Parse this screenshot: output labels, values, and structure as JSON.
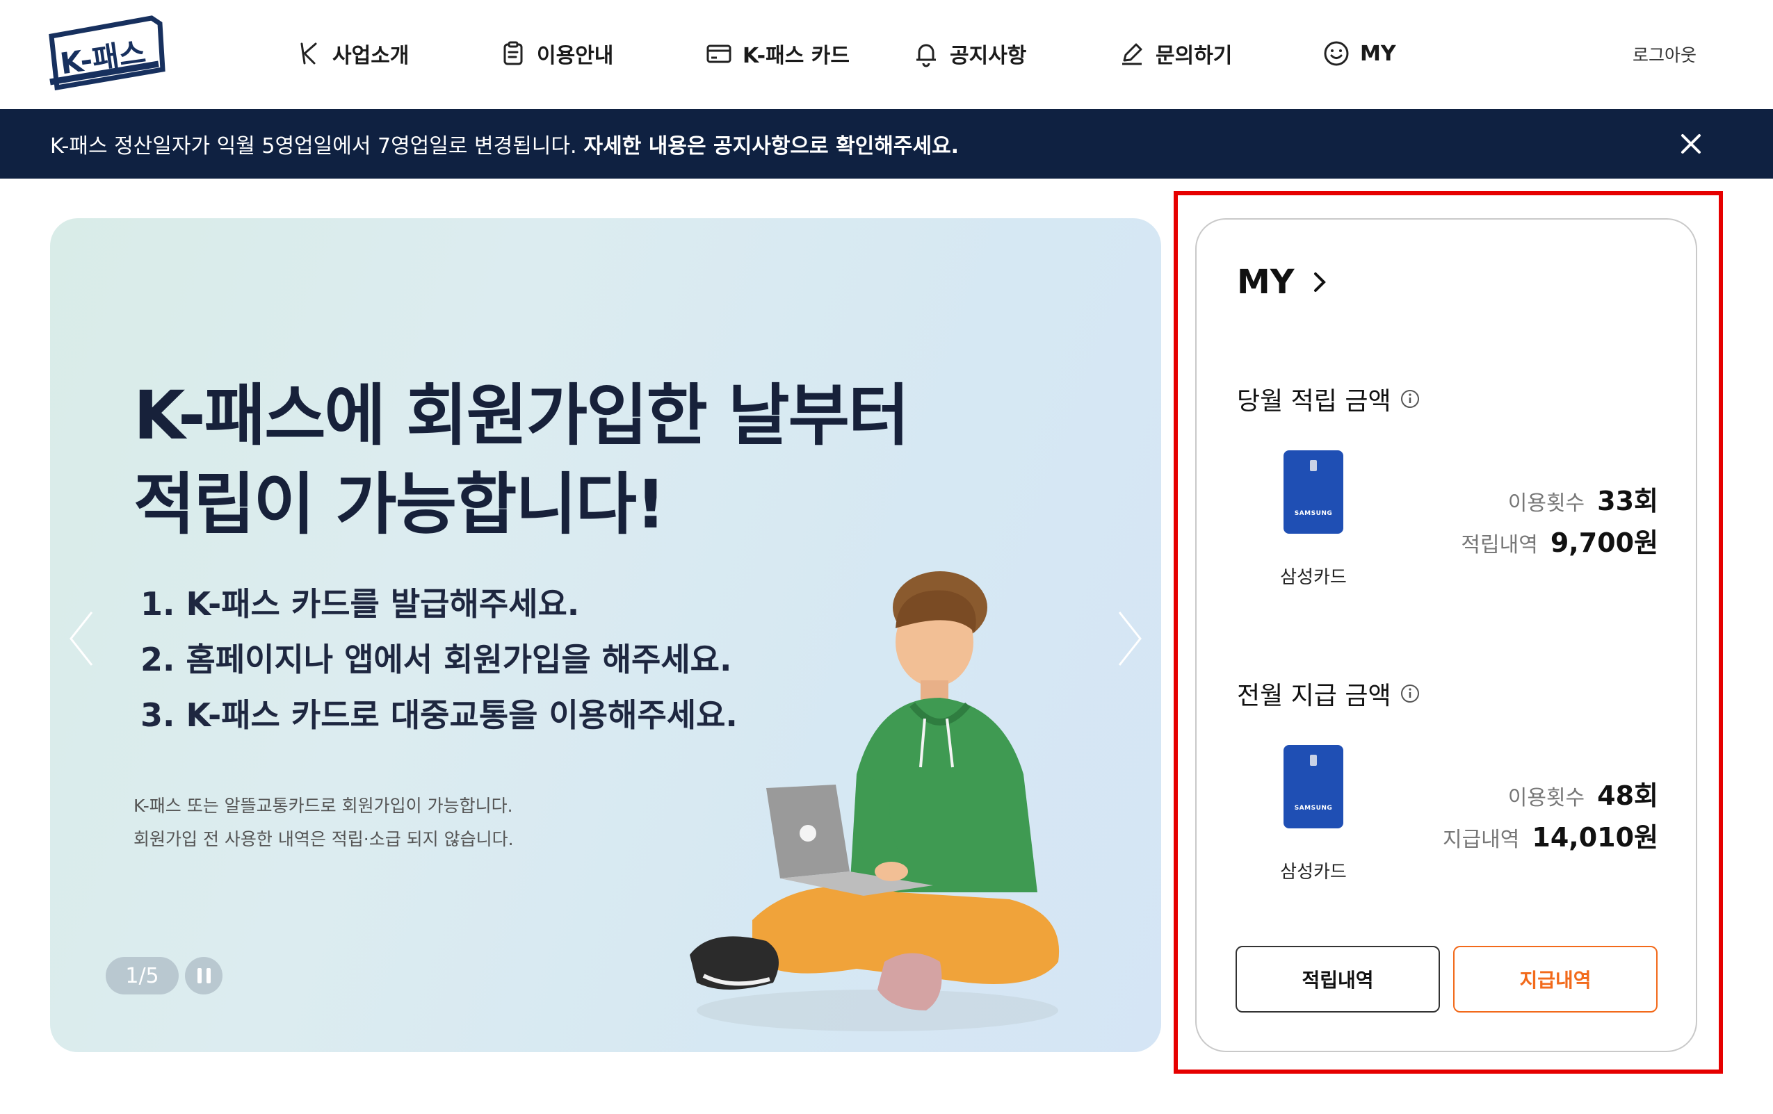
{
  "header": {
    "logo_text": "K-패스",
    "nav": [
      {
        "label": "사업소개",
        "icon": "k-symbol-icon"
      },
      {
        "label": "이용안내",
        "icon": "clipboard-icon"
      },
      {
        "label": "K-패스 카드",
        "icon": "credit-card-icon"
      },
      {
        "label": "공지사항",
        "icon": "bell-icon"
      },
      {
        "label": "문의하기",
        "icon": "pencil-icon"
      },
      {
        "label": "MY",
        "icon": "smiley-icon"
      }
    ],
    "logout": "로그아웃"
  },
  "notice": {
    "text": "K-패스 정산일자가 익월 5영업일에서 7영업일로 변경됩니다.",
    "emphasis": "자세한 내용은 공지사항으로 확인해주세요."
  },
  "banner": {
    "title_line1": "K-패스에 회원가입한 날부터",
    "title_line2": "적립이 가능합니다!",
    "steps": [
      "1. K-패스 카드를 발급해주세요.",
      "2. 홈페이지나 앱에서 회원가입을 해주세요.",
      "3. K-패스 카드로 대중교통을 이용해주세요."
    ],
    "note_line1": "K-패스 또는 알뜰교통카드로 회원가입이 가능합니다.",
    "note_line2": "회원가입 전 사용한 내역은 적립·소급 되지 않습니다.",
    "pager": "1/5"
  },
  "my": {
    "title": "MY",
    "current": {
      "title": "당월 적립 금액",
      "card_name": "삼성카드",
      "card_brand": "SAMSUNG",
      "count_label": "이용횟수",
      "count_value": "33회",
      "amount_label": "적립내역",
      "amount_value": "9,700원"
    },
    "previous": {
      "title": "전월 지급 금액",
      "card_name": "삼성카드",
      "card_brand": "SAMSUNG",
      "count_label": "이용횟수",
      "count_value": "48회",
      "amount_label": "지급내역",
      "amount_value": "14,010원"
    },
    "btn_earn": "적립내역",
    "btn_pay": "지급내역"
  },
  "colors": {
    "navy": "#0f2141",
    "accent_orange": "#f26a1b",
    "card_blue": "#1f4fb4",
    "highlight_red": "#e60000"
  }
}
